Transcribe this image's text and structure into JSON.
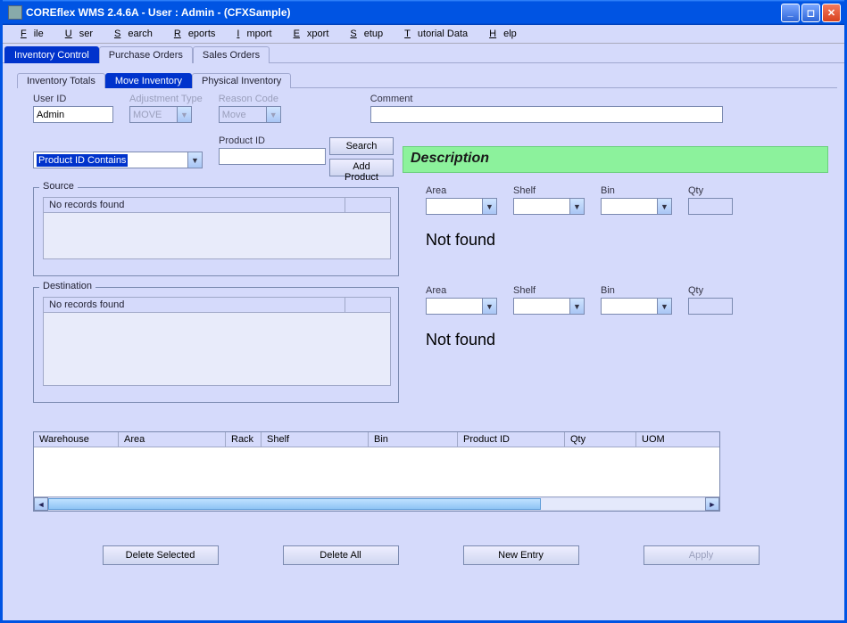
{
  "window": {
    "title": "COREflex WMS 2.4.6A - User : Admin - (CFXSample)"
  },
  "menu": {
    "file": "File",
    "user": "User",
    "search": "Search",
    "reports": "Reports",
    "import": "Import",
    "export": "Export",
    "setup": "Setup",
    "tutorial": "Tutorial Data",
    "help": "Help"
  },
  "main_tabs": {
    "inventory_control": "Inventory Control",
    "purchase_orders": "Purchase Orders",
    "sales_orders": "Sales Orders"
  },
  "sub_tabs": {
    "inventory_totals": "Inventory Totals",
    "move_inventory": "Move Inventory",
    "physical_inventory": "Physical Inventory"
  },
  "labels": {
    "user_id": "User ID",
    "adjustment_type": "Adjustment Type",
    "reason_code": "Reason Code",
    "comment": "Comment",
    "product_id": "Product ID",
    "description": "Description",
    "source": "Source",
    "destination": "Destination",
    "area": "Area",
    "shelf": "Shelf",
    "bin": "Bin",
    "qty": "Qty",
    "not_found": "Not found",
    "no_records": "No records found"
  },
  "values": {
    "user_id": "Admin",
    "adjustment_type": "MOVE",
    "reason_code": "Move",
    "search_mode": "Product ID Contains",
    "product_id": "",
    "comment": ""
  },
  "buttons": {
    "search": "Search",
    "add_product": "Add Product",
    "delete_selected": "Delete Selected",
    "delete_all": "Delete All",
    "new_entry": "New Entry",
    "apply": "Apply"
  },
  "bottom_grid": {
    "warehouse": "Warehouse",
    "area": "Area",
    "rack": "Rack",
    "shelf": "Shelf",
    "bin": "Bin",
    "product_id": "Product ID",
    "qty": "Qty",
    "uom": "UOM"
  }
}
